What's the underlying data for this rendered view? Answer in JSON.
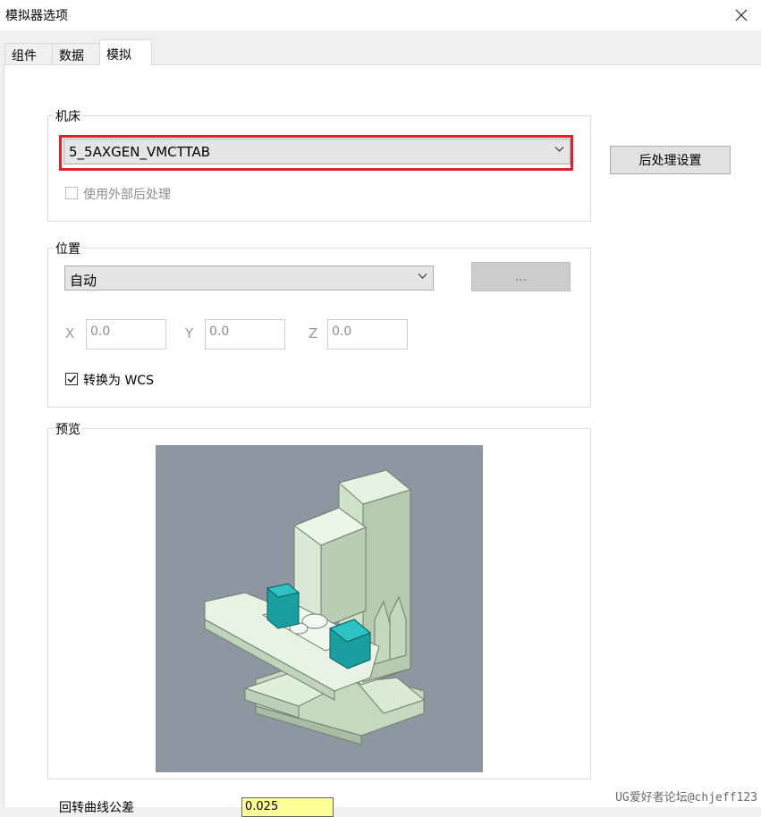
{
  "window": {
    "title": "模拟器选项",
    "close_icon": "close-icon"
  },
  "tabs": [
    {
      "label": "组件",
      "active": false
    },
    {
      "label": "数据",
      "active": false
    },
    {
      "label": "模拟",
      "active": true
    }
  ],
  "machine": {
    "group_label": "机床",
    "selected": "5_5AXGEN_VMCTTAB",
    "highlight_color": "#e0212b",
    "use_external_post_label": "使用外部后处理",
    "use_external_post_checked": false,
    "use_external_post_enabled": false,
    "post_settings_button": "后处理设置"
  },
  "position": {
    "group_label": "位置",
    "selected": "自动",
    "ellipsis_button": "...",
    "x_label": "X",
    "x_value": "0.0",
    "y_label": "Y",
    "y_value": "0.0",
    "z_label": "Z",
    "z_value": "0.0",
    "convert_wcs_label": "转换为 WCS",
    "convert_wcs_checked": true
  },
  "preview": {
    "group_label": "预览",
    "background_color": "#8e97a1",
    "machine_color": "#d4e6d0",
    "head_color": "#1a9ea0"
  },
  "bottom": {
    "label": "回转曲线公差",
    "value": "0.025"
  },
  "watermark": "UG爱好者论坛@chjeff123"
}
